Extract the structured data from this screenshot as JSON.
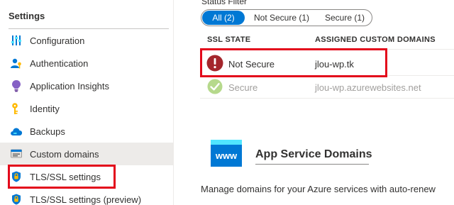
{
  "sidebar": {
    "heading": "Settings",
    "items": [
      {
        "label": "Configuration",
        "icon": "configuration-icon"
      },
      {
        "label": "Authentication",
        "icon": "authentication-icon"
      },
      {
        "label": "Application Insights",
        "icon": "application-insights-icon"
      },
      {
        "label": "Identity",
        "icon": "identity-icon"
      },
      {
        "label": "Backups",
        "icon": "backups-icon"
      },
      {
        "label": "Custom domains",
        "icon": "custom-domains-icon"
      },
      {
        "label": "TLS/SSL settings",
        "icon": "tls-ssl-shield-icon"
      },
      {
        "label": "TLS/SSL settings (preview)",
        "icon": "tls-ssl-shield-icon"
      }
    ]
  },
  "status_filter": {
    "label": "Status Filter",
    "options": [
      "All (2)",
      "Not Secure (1)",
      "Secure (1)"
    ],
    "selected": "All (2)"
  },
  "table": {
    "columns": [
      "SSL STATE",
      "ASSIGNED CUSTOM DOMAINS"
    ],
    "rows": [
      {
        "state": "Not Secure",
        "domain": "jlou-wp.tk",
        "status_icon": "error-icon"
      },
      {
        "state": "Secure",
        "domain": "jlou-wp.azurewebsites.net",
        "status_icon": "check-icon"
      }
    ]
  },
  "app_service_domains": {
    "icon_text": "www",
    "title": "App Service Domains",
    "description": "Manage domains for your Azure services with auto-renew"
  },
  "colors": {
    "accent": "#0078d4",
    "highlight": "#e3081b",
    "error": "#a4262c",
    "success": "#92c353"
  }
}
